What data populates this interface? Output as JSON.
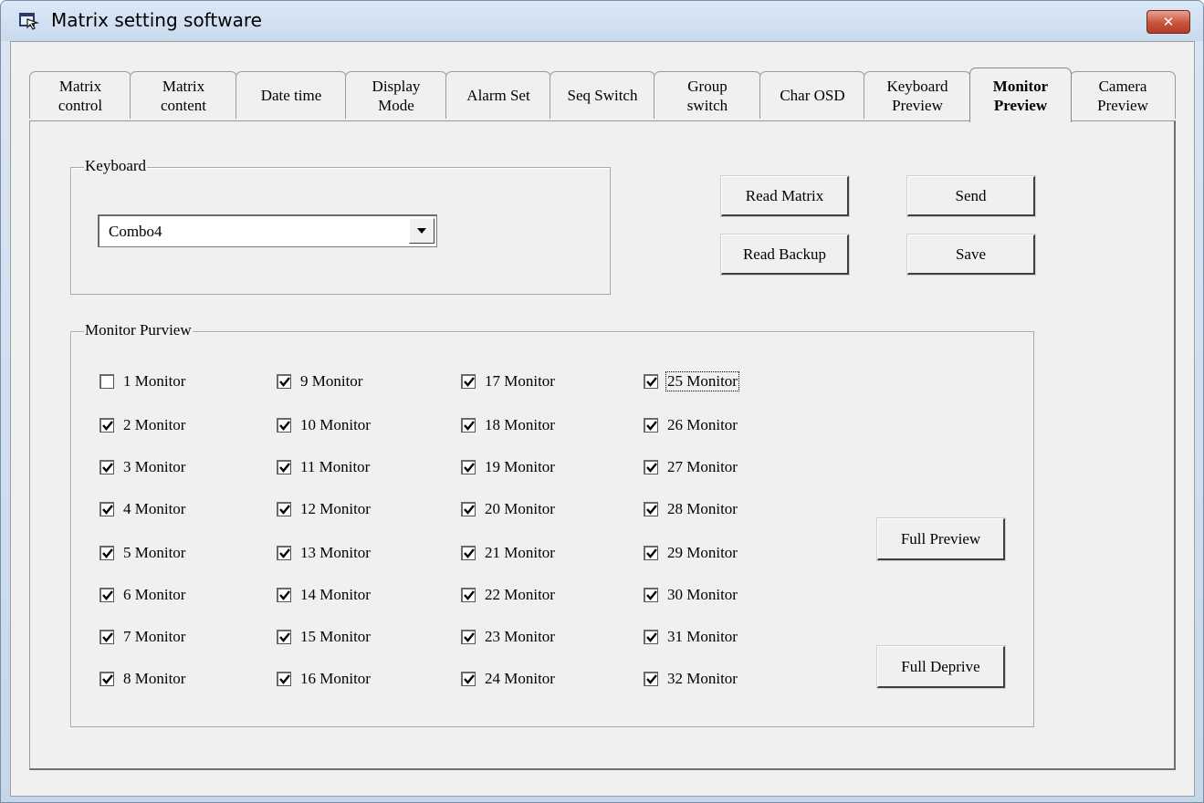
{
  "window": {
    "title": "Matrix setting software",
    "close_label": "✕"
  },
  "tabs": [
    {
      "label": "Matrix\ncontrol",
      "active": false
    },
    {
      "label": "Matrix\ncontent",
      "active": false
    },
    {
      "label": "Date  time",
      "active": false
    },
    {
      "label": "Display\nMode",
      "active": false
    },
    {
      "label": "Alarm  Set",
      "active": false
    },
    {
      "label": "Seq Switch",
      "active": false
    },
    {
      "label": "Group\nswitch",
      "active": false
    },
    {
      "label": "Char OSD",
      "active": false
    },
    {
      "label": "Keyboard\nPreview",
      "active": false
    },
    {
      "label": "Monitor\nPreview",
      "active": true
    },
    {
      "label": "Camera\nPreview",
      "active": false
    }
  ],
  "keyboard_group": {
    "legend": "Keyboard",
    "combo_value": "Combo4"
  },
  "buttons": {
    "read_matrix": "Read Matrix",
    "read_backup": "Read Backup",
    "send": "Send",
    "save": "Save",
    "full_preview": "Full Preview",
    "full_deprive": "Full Deprive"
  },
  "monitor_group": {
    "legend": "Monitor Purview",
    "monitors": [
      {
        "label": "1 Monitor",
        "checked": false
      },
      {
        "label": "2 Monitor",
        "checked": true
      },
      {
        "label": "3 Monitor",
        "checked": true
      },
      {
        "label": "4 Monitor",
        "checked": true
      },
      {
        "label": "5 Monitor",
        "checked": true
      },
      {
        "label": "6 Monitor",
        "checked": true
      },
      {
        "label": "7 Monitor",
        "checked": true
      },
      {
        "label": "8 Monitor",
        "checked": true
      },
      {
        "label": "9 Monitor",
        "checked": true
      },
      {
        "label": "10 Monitor",
        "checked": true
      },
      {
        "label": "11 Monitor",
        "checked": true
      },
      {
        "label": "12 Monitor",
        "checked": true
      },
      {
        "label": "13 Monitor",
        "checked": true
      },
      {
        "label": "14 Monitor",
        "checked": true
      },
      {
        "label": "15 Monitor",
        "checked": true
      },
      {
        "label": "16 Monitor",
        "checked": true
      },
      {
        "label": "17 Monitor",
        "checked": true
      },
      {
        "label": "18 Monitor",
        "checked": true
      },
      {
        "label": "19 Monitor",
        "checked": true
      },
      {
        "label": "20 Monitor",
        "checked": true
      },
      {
        "label": "21 Monitor",
        "checked": true
      },
      {
        "label": "22 Monitor",
        "checked": true
      },
      {
        "label": "23 Monitor",
        "checked": true
      },
      {
        "label": "24 Monitor",
        "checked": true
      },
      {
        "label": "25 Monitor",
        "checked": true,
        "focused": true
      },
      {
        "label": "26 Monitor",
        "checked": true
      },
      {
        "label": "27 Monitor",
        "checked": true
      },
      {
        "label": "28 Monitor",
        "checked": true
      },
      {
        "label": "29 Monitor",
        "checked": true
      },
      {
        "label": "30 Monitor",
        "checked": true
      },
      {
        "label": "31 Monitor",
        "checked": true
      },
      {
        "label": "32 Monitor",
        "checked": true
      }
    ]
  }
}
